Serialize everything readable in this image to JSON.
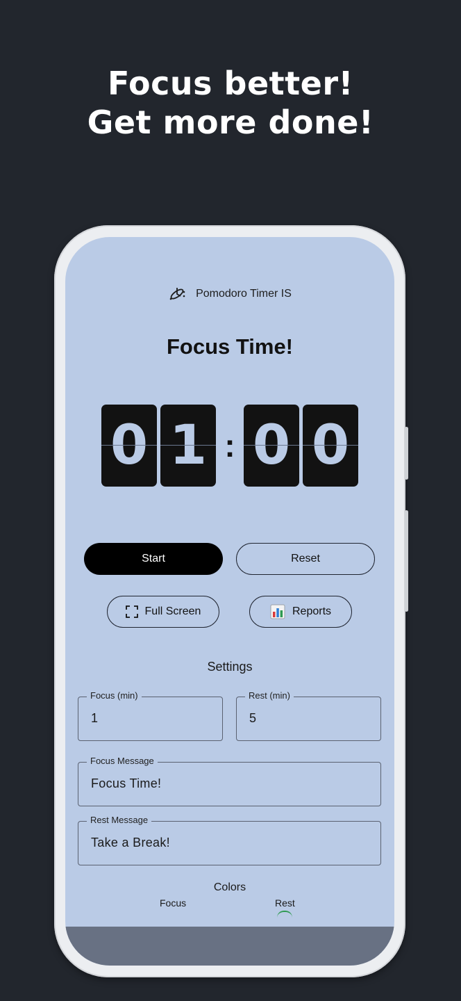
{
  "promo": {
    "line1": "Focus better!",
    "line2": "Get more done!"
  },
  "app": {
    "name": "Pomodoro Timer IS",
    "logo_icon": "atom-clock-icon",
    "timer_title": "Focus Time!",
    "timer": {
      "d1": "0",
      "d2": "1",
      "sep": ":",
      "d3": "0",
      "d4": "0"
    },
    "buttons": {
      "start": "Start",
      "reset": "Reset",
      "fullscreen": "Full Screen",
      "reports": "Reports"
    },
    "settings": {
      "heading": "Settings",
      "focus_label": "Focus (min)",
      "focus_value": "1",
      "rest_label": "Rest (min)",
      "rest_value": "5",
      "focus_msg_label": "Focus Message",
      "focus_msg_value": "Focus Time!",
      "rest_msg_label": "Rest Message",
      "rest_msg_value": "Take a Break!"
    },
    "colors": {
      "heading": "Colors",
      "focus": "Focus",
      "rest": "Rest"
    }
  },
  "theme": {
    "background": "#22262d",
    "screen": "#bacbe6",
    "digit_bg": "#121212",
    "accent_rest": "#2f9a52"
  }
}
